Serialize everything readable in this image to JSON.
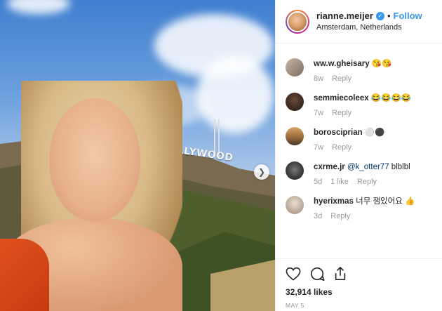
{
  "photo": {
    "sign_text": "HOLLYWOOD"
  },
  "header": {
    "username": "rianne.meijer",
    "dot": "•",
    "follow_label": "Follow",
    "location": "Amsterdam, Netherlands"
  },
  "comments": [
    {
      "user": "ww.w.gheisary",
      "text": "😘😘",
      "time": "8w",
      "likes": "",
      "reply": "Reply"
    },
    {
      "user": "semmiecoleex",
      "text": "😂😂😂😂",
      "time": "7w",
      "likes": "",
      "reply": "Reply"
    },
    {
      "user": "borosciprian",
      "text": "⚪⚫",
      "time": "7w",
      "likes": "",
      "reply": "Reply"
    },
    {
      "user": "cxrme.jr",
      "mention": "@k_otter77",
      "text": "blblbl",
      "time": "5d",
      "likes": "1 like",
      "reply": "Reply"
    },
    {
      "user": "hyerixmas",
      "text": "너무 잼있어요 👍",
      "time": "3d",
      "likes": "",
      "reply": "Reply"
    }
  ],
  "post": {
    "likes": "32,914 likes",
    "date": "May 5"
  },
  "colors": {
    "accent": "#3897f0",
    "swimsuit": "#d9461a"
  }
}
